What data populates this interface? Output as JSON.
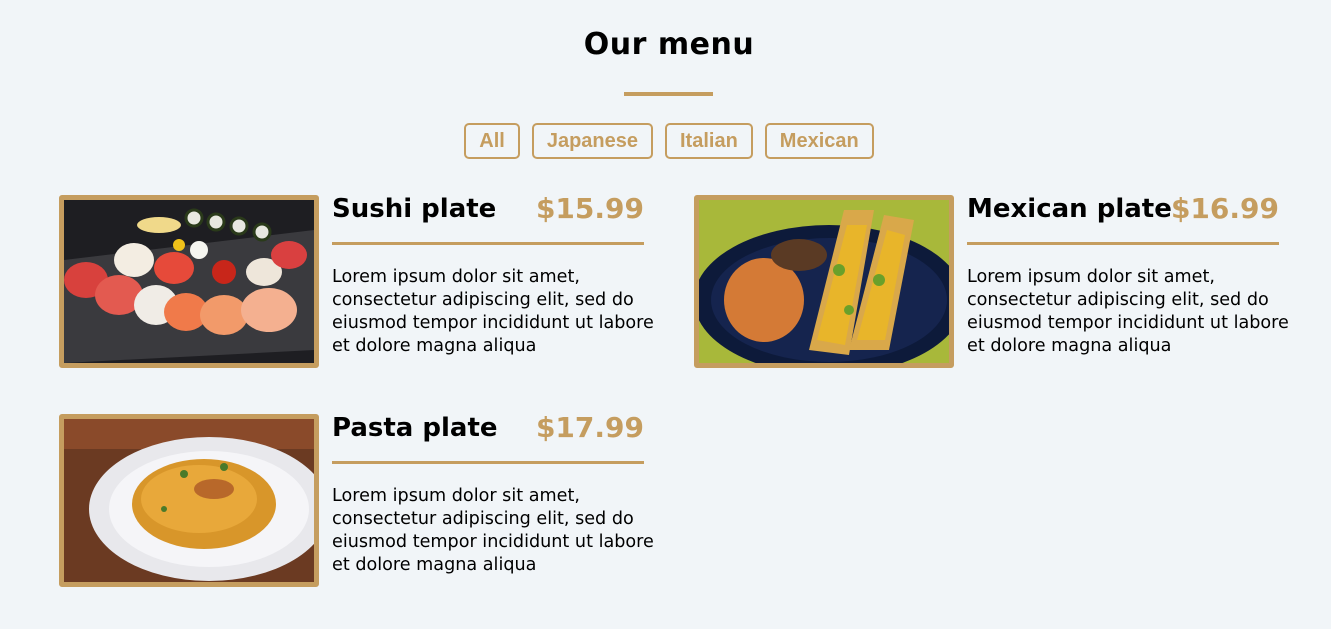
{
  "header": {
    "title": "Our menu"
  },
  "filters": [
    {
      "label": "All"
    },
    {
      "label": "Japanese"
    },
    {
      "label": "Italian"
    },
    {
      "label": "Mexican"
    }
  ],
  "menu_items": [
    {
      "name": "Sushi plate",
      "price": "$15.99",
      "description": "Lorem ipsum dolor sit amet, consectetur adipiscing elit, sed do eiusmod tempor incididunt ut labore et dolore magna aliqua",
      "image": "sushi-photo"
    },
    {
      "name": "Mexican plate",
      "price": "$16.99",
      "description": "Lorem ipsum dolor sit amet, consectetur adipiscing elit, sed do eiusmod tempor incididunt ut labore et dolore magna aliqua",
      "image": "tacos-photo"
    },
    {
      "name": "Pasta plate",
      "price": "$17.99",
      "description": "Lorem ipsum dolor sit amet, consectetur adipiscing elit, sed do eiusmod tempor incididunt ut labore et dolore magna aliqua",
      "image": "pasta-photo"
    }
  ],
  "colors": {
    "accent": "#c59d5f",
    "background": "#f1f5f8",
    "text": "#000000"
  }
}
